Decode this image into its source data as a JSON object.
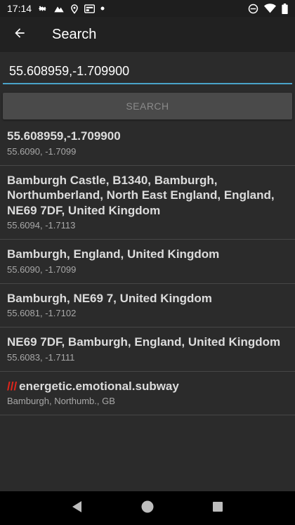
{
  "statusbar": {
    "time": "17:14",
    "icons_left": [
      "settings-icon",
      "mountain-icon",
      "location-icon",
      "news-icon",
      "dot-icon"
    ],
    "icons_right": [
      "do-not-disturb-icon",
      "wifi-icon",
      "battery-icon"
    ]
  },
  "appbar": {
    "title": "Search",
    "back_icon": "arrow-back-icon"
  },
  "search": {
    "value": "55.608959,-1.709900",
    "button_label": "SEARCH",
    "accent_color": "#4aa3c8"
  },
  "results": [
    {
      "title": "55.608959,-1.709900",
      "subtitle": "55.6090, -1.7099"
    },
    {
      "title": "Bamburgh Castle, B1340, Bamburgh, Northumberland, North East England, England, NE69 7DF, United Kingdom",
      "subtitle": "55.6094, -1.7113"
    },
    {
      "title": "Bamburgh, England, United Kingdom",
      "subtitle": "55.6090, -1.7099"
    },
    {
      "title": "Bamburgh, NE69 7, United Kingdom",
      "subtitle": "55.6081, -1.7102"
    },
    {
      "title": "NE69 7DF, Bamburgh, England, United Kingdom",
      "subtitle": "55.6083, -1.7111"
    },
    {
      "prefix": "///",
      "title": "energetic.emotional.subway",
      "subtitle": "Bamburgh, Northumb., GB",
      "prefix_color": "#e1251b"
    }
  ],
  "navbar": {
    "icons": [
      "back-triangle-icon",
      "home-circle-icon",
      "recents-square-icon"
    ]
  }
}
